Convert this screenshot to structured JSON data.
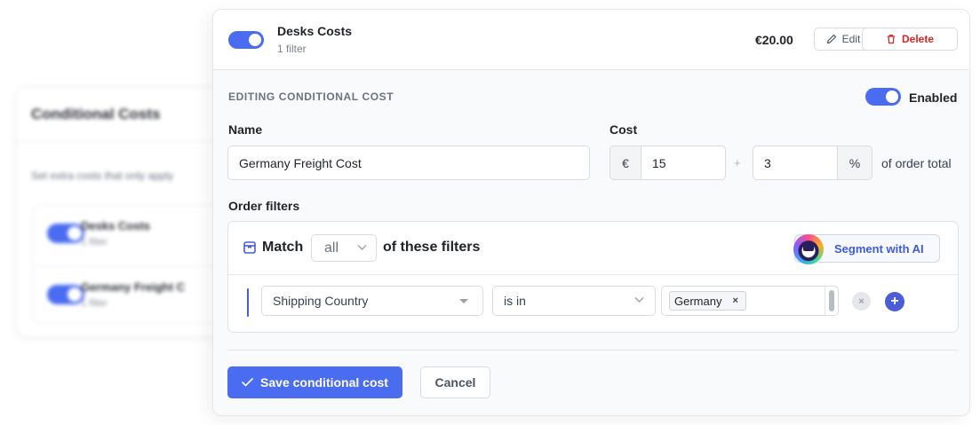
{
  "background_card": {
    "title": "Conditional Costs",
    "description": "Set extra costs that only apply",
    "items": [
      {
        "name": "Desks Costs",
        "sub": "1 filter"
      },
      {
        "name": "Germany Freight C",
        "sub": "1 filter"
      }
    ]
  },
  "header": {
    "title": "Desks Costs",
    "subtitle": "1 filter",
    "price": "€20.00",
    "edit_label": "Edit",
    "delete_label": "Delete",
    "enabled": true
  },
  "editor": {
    "section_label": "EDITING CONDITIONAL COST",
    "enabled_label": "Enabled",
    "name_label": "Name",
    "name_value": "Germany Freight Cost",
    "cost_label": "Cost",
    "currency_symbol": "€",
    "cost_value": "15",
    "plus_symbol": "+",
    "percent_value": "3",
    "percent_symbol": "%",
    "percent_suffix": "of order total"
  },
  "filters": {
    "label": "Order filters",
    "match_prefix": "Match",
    "match_value": "all",
    "match_suffix": "of these filters",
    "segment_label": "Segment with AI",
    "rule": {
      "field": "Shipping Country",
      "operator": "is in",
      "value_chip": "Germany",
      "chip_remove": "×",
      "remove_symbol": "×",
      "add_symbol": "+"
    }
  },
  "footer": {
    "save_label": "Save conditional cost",
    "cancel_label": "Cancel"
  },
  "colors": {
    "accent": "#4a6cf0",
    "danger": "#dc2626",
    "rule_accent": "#4a5cd6"
  }
}
